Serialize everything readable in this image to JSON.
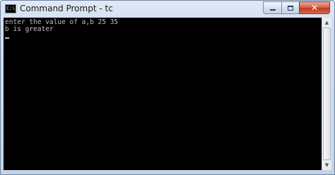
{
  "window": {
    "title": "Command Prompt - tc",
    "app_icon_glyph": "C:\\",
    "controls": {
      "minimize_icon": "minimize-icon",
      "maximize_icon": "maximize-icon",
      "close_glyph": "✕"
    }
  },
  "console": {
    "lines": [
      "enter the value of a,b 25 35",
      "b is greater"
    ]
  },
  "scrollbar": {
    "up_glyph": "▲",
    "down_glyph": "▼"
  },
  "colors": {
    "console_background": "#000000",
    "console_text": "#c0c0c0",
    "close_button": "#c2391c"
  }
}
